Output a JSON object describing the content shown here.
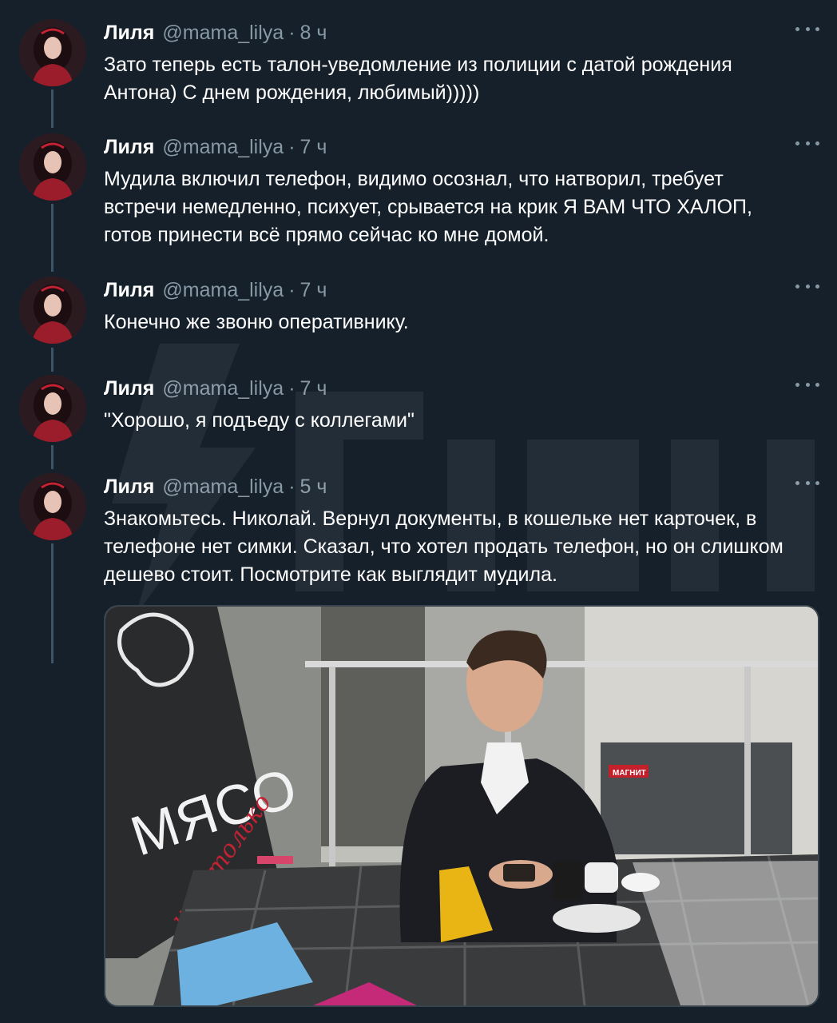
{
  "author": {
    "display_name": "Лиля",
    "handle": "@mama_lilya"
  },
  "tweets": [
    {
      "time": "8 ч",
      "text": "Зато теперь есть талон-уведомление из полиции с датой рождения\nАнтона) С днем рождения, любимый)))))"
    },
    {
      "time": "7 ч",
      "text": "Мудила включил телефон, видимо осознал, что натворил, требует\nвстречи немедленно, психует, срывается на крик Я ВАМ ЧТО ХАЛОП,\nготов принести всё прямо сейчас ко мне домой."
    },
    {
      "time": "7 ч",
      "text": "Конечно же звоню оперативнику."
    },
    {
      "time": "7 ч",
      "text": "\"Хорошо, я подъеду с коллегами\""
    },
    {
      "time": "5 ч",
      "text": "Знакомьтесь. Николай. Вернул документы, в кошельке нет карточек, в\nтелефоне нет симки. Сказал, что хотел продать телефон, но он слишком\nдешево стоит. Посмотрите как выглядит мудила."
    }
  ],
  "separator": "·",
  "media": {
    "sign_text": "МЯСО",
    "sign_script": "и не только",
    "store_sign": "МАГНИТ"
  },
  "colors": {
    "background": "#15202b",
    "secondary_text": "#8899a6",
    "thread_line": "#3d5466",
    "primary_text": "#ffffff"
  }
}
